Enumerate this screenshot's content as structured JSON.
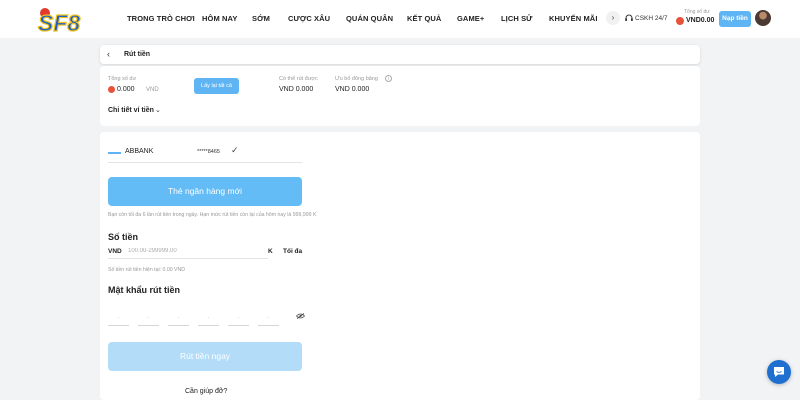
{
  "brand": {
    "logo_text": "SF8",
    "colors": {
      "accent": "#5fb4f3",
      "primary_button": "#64bcf7",
      "disabled_button": "#b3dcf8",
      "coin": "#e8523a",
      "chat": "#1f6fd1",
      "logo_yellow": "#f2c21b",
      "logo_blue": "#1d5fc8",
      "logo_red": "#e23a2e"
    }
  },
  "nav": {
    "items": [
      {
        "label": "TRONG TRÒ CHƠI"
      },
      {
        "label": "HÔM NAY"
      },
      {
        "label": "SỚM"
      },
      {
        "label": "CƯỢC XÂU"
      },
      {
        "label": "QUÁN QUÂN"
      },
      {
        "label": "KẾT QUẢ"
      },
      {
        "label": "GAME+"
      },
      {
        "label": "LỊCH SỬ"
      },
      {
        "label": "KHUYẾN MÃI"
      }
    ],
    "more_icon": "chevron-right-icon",
    "support_label": "CSKH 24/7",
    "support_icon": "headset-icon",
    "balance_label": "Tổng số dư",
    "balance_value": "VND0.00",
    "deposit_label": "Nạp tiền"
  },
  "page": {
    "back_icon": "chevron-left-icon",
    "title": "Rút tiền"
  },
  "summary": {
    "total_label": "Tổng số dư",
    "total_value": "0.000",
    "total_unit": "VND",
    "collect_all_label": "Lấy lại tất cả",
    "withdrawable_label": "Có thể rút được",
    "withdrawable_value": "VND 0.000",
    "frozen_label": "Ưu bổ đông băng",
    "frozen_value": "VND 0.000",
    "info_icon": "info-icon",
    "detail_label": "Chi tiết ví tiền"
  },
  "bank": {
    "name": "ABBANK",
    "account_masked": "*****8465",
    "selected_icon": "check-icon",
    "new_card_label": "Thẻ ngân hàng mới",
    "limit_note": "Bạn còn tối đa 6 lần rút tiền trong ngày. Hạn mức rút tiền còn lại của hôm nay là 999,999 K"
  },
  "amount": {
    "title": "Số tiền",
    "currency": "VND",
    "placeholder": "100.00-299999.00",
    "unit": "K",
    "max_label": "Tối đa",
    "remaining_note": "Số tiền rút tiền hiện tại: 0.00 VND"
  },
  "password": {
    "title": "Mật khẩu rút tiền",
    "digit_count": 6,
    "toggle_icon": "eye-slash-icon"
  },
  "actions": {
    "submit_label": "Rút tiền ngay",
    "help_label": "Cần giúp đỡ?",
    "chat_icon": "chat-bubble-icon"
  }
}
